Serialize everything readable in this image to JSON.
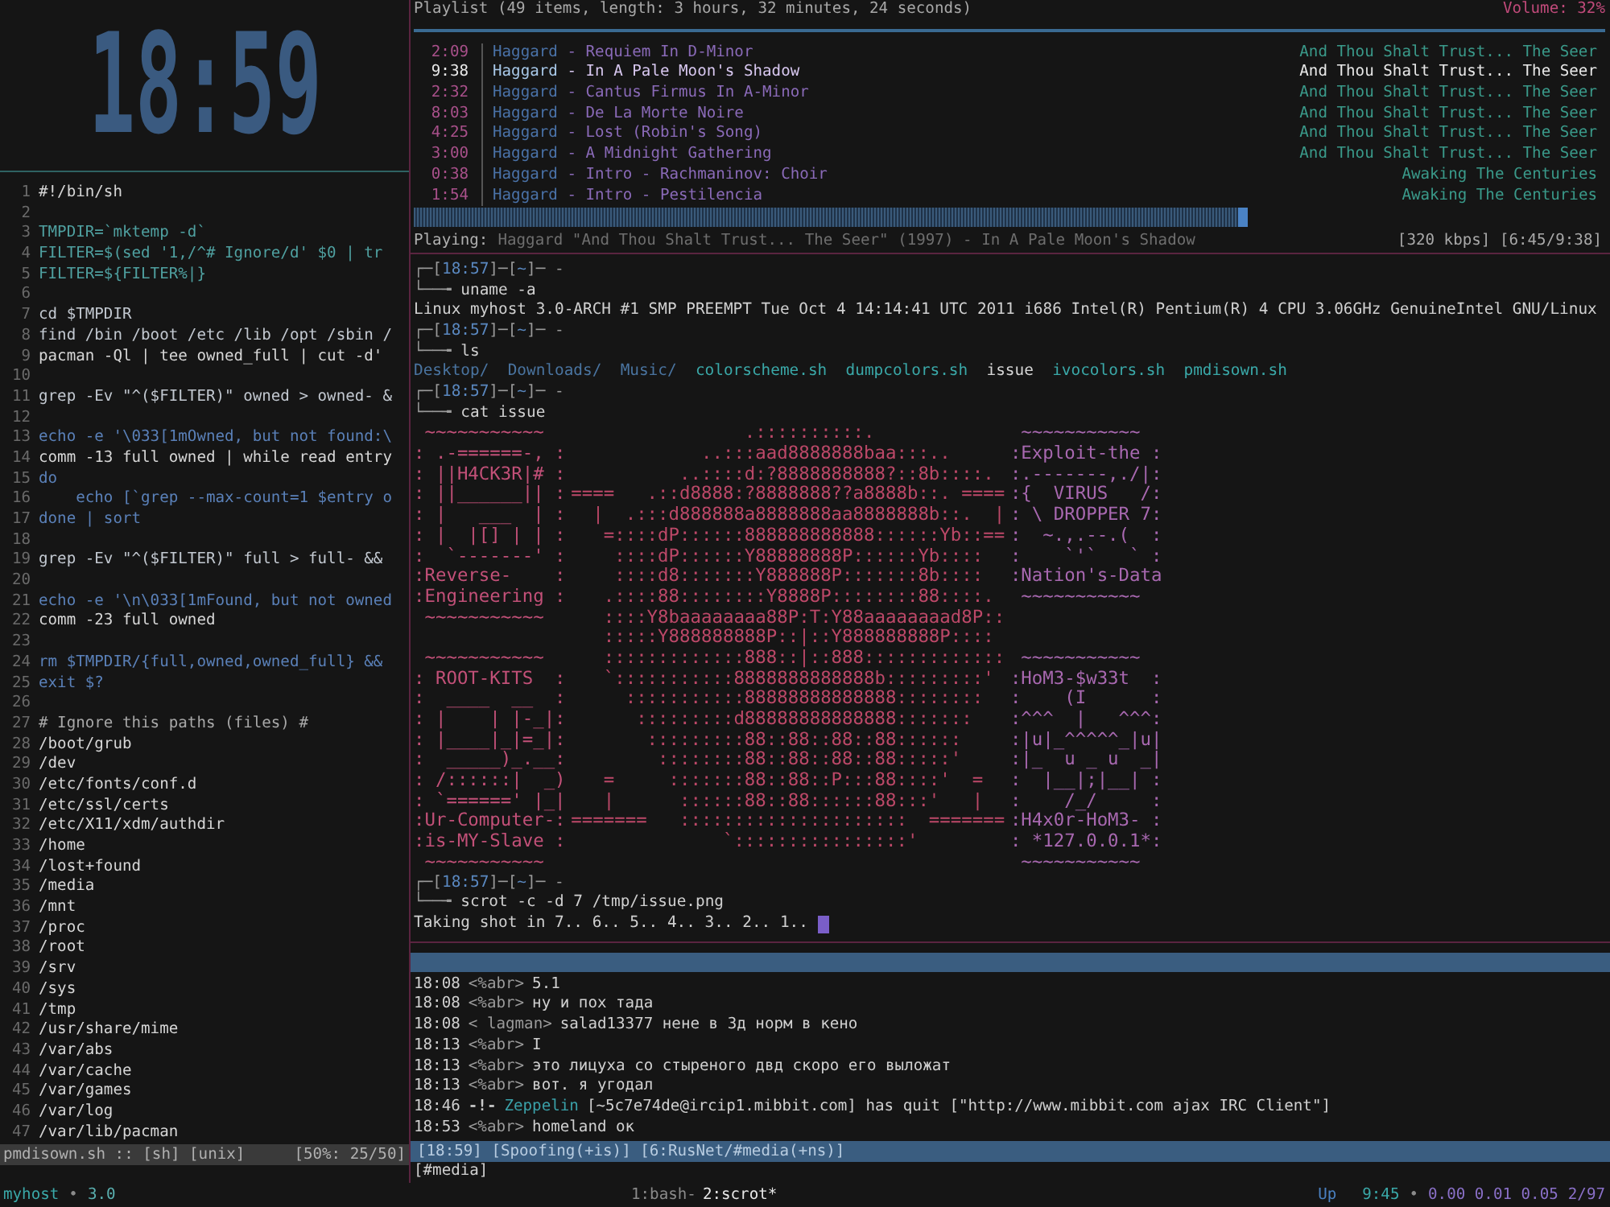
{
  "clock": "18:59",
  "editor": {
    "lines": [
      {
        "n": "1",
        "code": "#!/bin/sh",
        "kind": "plain"
      },
      {
        "n": "2"
      },
      {
        "n": "3",
        "code": "TMPDIR=`mktemp -d`",
        "kind": "assign"
      },
      {
        "n": "4",
        "code": "FILTER=$(sed '1,/^# Ignore/d' $0 | tr",
        "kind": "assign"
      },
      {
        "n": "5",
        "code": "FILTER=${FILTER%|}",
        "kind": "assign"
      },
      {
        "n": "6"
      },
      {
        "n": "7",
        "code": "cd $TMPDIR",
        "kind": "command"
      },
      {
        "n": "8",
        "code": "find /bin /boot /etc /lib /opt /sbin /",
        "kind": "command"
      },
      {
        "n": "9",
        "code": "pacman -Ql | tee owned_full | cut -d'",
        "kind": "plain"
      },
      {
        "n": "10"
      },
      {
        "n": "11",
        "code": "grep -Ev \"^($FILTER)\" owned > owned- &",
        "kind": "command"
      },
      {
        "n": "12"
      },
      {
        "n": "13",
        "code": "echo -e '\\033[1mOwned, but not found:\\",
        "kind": "keyword"
      },
      {
        "n": "14",
        "code": "comm -13 full owned | while read entry",
        "kind": "plain"
      },
      {
        "n": "15",
        "code": "do",
        "kind": "keyword"
      },
      {
        "n": "16",
        "code": "    echo [`grep --max-count=1 $entry o",
        "kind": "keyword"
      },
      {
        "n": "17",
        "code": "done | sort",
        "kind": "keyword"
      },
      {
        "n": "18"
      },
      {
        "n": "19",
        "code": "grep -Ev \"^($FILTER)\" full > full- &&",
        "kind": "command"
      },
      {
        "n": "20"
      },
      {
        "n": "21",
        "code": "echo -e '\\n\\033[1mFound, but not owned",
        "kind": "keyword"
      },
      {
        "n": "22",
        "code": "comm -23 full owned",
        "kind": "plain"
      },
      {
        "n": "23"
      },
      {
        "n": "24",
        "code": "rm $TMPDIR/{full,owned,owned_full} &&",
        "kind": "keyword"
      },
      {
        "n": "25",
        "code": "exit $?",
        "kind": "keyword"
      },
      {
        "n": "26"
      },
      {
        "n": "27",
        "code": "# Ignore this paths (files) #",
        "kind": "comment"
      },
      {
        "n": "28",
        "code": "/boot/grub",
        "kind": "plain"
      },
      {
        "n": "29",
        "code": "/dev",
        "kind": "plain"
      },
      {
        "n": "30",
        "code": "/etc/fonts/conf.d",
        "kind": "plain"
      },
      {
        "n": "31",
        "code": "/etc/ssl/certs",
        "kind": "plain"
      },
      {
        "n": "32",
        "code": "/etc/X11/xdm/authdir",
        "kind": "plain"
      },
      {
        "n": "33",
        "code": "/home",
        "kind": "plain"
      },
      {
        "n": "34",
        "code": "/lost+found",
        "kind": "plain"
      },
      {
        "n": "35",
        "code": "/media",
        "kind": "plain"
      },
      {
        "n": "36",
        "code": "/mnt",
        "kind": "plain"
      },
      {
        "n": "37",
        "code": "/proc",
        "kind": "plain"
      },
      {
        "n": "38",
        "code": "/root",
        "kind": "plain"
      },
      {
        "n": "39",
        "code": "/srv",
        "kind": "plain"
      },
      {
        "n": "40",
        "code": "/sys",
        "kind": "plain"
      },
      {
        "n": "41",
        "code": "/tmp",
        "kind": "plain"
      },
      {
        "n": "42",
        "code": "/usr/share/mime",
        "kind": "plain"
      },
      {
        "n": "43",
        "code": "/var/abs",
        "kind": "plain"
      },
      {
        "n": "44",
        "code": "/var/cache",
        "kind": "plain"
      },
      {
        "n": "45",
        "code": "/var/games",
        "kind": "plain"
      },
      {
        "n": "46",
        "code": "/var/log",
        "kind": "plain"
      },
      {
        "n": "47",
        "code": "/var/lib/pacman",
        "kind": "plain"
      }
    ],
    "status": {
      "file": "pmdisown.sh :: [sh] [unix]",
      "position": "[50%: 25/50]"
    }
  },
  "playlist": {
    "header": "Playlist (49 items, length: 3 hours, 32 minutes, 24 seconds)",
    "volume": "Volume: 32%",
    "tracks": [
      {
        "time": "2:09",
        "artist": "Haggard",
        "title": "- Requiem In D-Minor",
        "album": "And Thou Shalt Trust... The Seer",
        "selected": false
      },
      {
        "time": "9:38",
        "artist": "Haggard",
        "title": "- In A Pale Moon's Shadow",
        "album": "And Thou Shalt Trust... The Seer",
        "selected": true
      },
      {
        "time": "2:32",
        "artist": "Haggard",
        "title": "- Cantus Firmus In A-Minor",
        "album": "And Thou Shalt Trust... The Seer",
        "selected": false
      },
      {
        "time": "8:03",
        "artist": "Haggard",
        "title": "- De La Morte Noire",
        "album": "And Thou Shalt Trust... The Seer",
        "selected": false
      },
      {
        "time": "4:25",
        "artist": "Haggard",
        "title": "- Lost (Robin's Song)",
        "album": "And Thou Shalt Trust... The Seer",
        "selected": false
      },
      {
        "time": "3:00",
        "artist": "Haggard",
        "title": "- A Midnight Gathering",
        "album": "And Thou Shalt Trust... The Seer",
        "selected": false
      },
      {
        "time": "0:38",
        "artist": "Haggard",
        "title": "- Intro - Rachmaninov: Choir",
        "album": "Awaking The Centuries",
        "selected": false
      },
      {
        "time": "1:54",
        "artist": "Haggard",
        "title": "- Intro - Pestilencia",
        "album": "Awaking The Centuries",
        "selected": false
      }
    ],
    "progress": {
      "level": 0.7
    },
    "playing_label": "Playing:",
    "now_playing": "Haggard \"And Thou Shalt Trust... The Seer\" (1997) - In A Pale Moon's Shadow",
    "bitrate_time": "[320 kbps] [6:45/9:38]"
  },
  "terminal": [
    {
      "kind": "prompt",
      "segments": [
        "┌─[",
        "18:57",
        "]─[",
        "~",
        "]─ -"
      ],
      "arrow": "└──╼",
      "command": "uname -a"
    },
    {
      "kind": "output",
      "text": "Linux myhost 3.0-ARCH #1 SMP PREEMPT Tue Oct 4 14:14:41 UTC 2011 i686 Intel(R) Pentium(R) 4 CPU 3.06GHz GenuineIntel GNU/Linux"
    },
    {
      "kind": "prompt",
      "segments": [
        "┌─[",
        "18:57",
        "]─[",
        "~",
        "]─ -"
      ],
      "arrow": "└──╼",
      "command": "ls"
    },
    {
      "kind": "listing",
      "items": [
        {
          "name": "Desktop/",
          "kind": "dir"
        },
        {
          "name": "Downloads/",
          "kind": "dir"
        },
        {
          "name": "Music/",
          "kind": "dir"
        },
        {
          "name": "colorscheme.sh",
          "kind": "script"
        },
        {
          "name": "dumpcolors.sh",
          "kind": "script"
        },
        {
          "name": "issue",
          "kind": "file"
        },
        {
          "name": "ivocolors.sh",
          "kind": "script"
        },
        {
          "name": "pmdisown.sh",
          "kind": "script"
        }
      ]
    },
    {
      "kind": "prompt",
      "segments": [
        "┌─[",
        "18:57",
        "]─[",
        "~",
        "]─ -"
      ],
      "arrow": "└──╼",
      "command": "cat issue"
    },
    {
      "kind": "art",
      "rows": [
        {
          "left": " ~~~~~~~~~~~ ",
          "middle": "                .::::::::::.",
          "right": " ~~~~~~~~~~~ "
        },
        {
          "left": ": .-======-, :",
          "middle": "            ..:::aad8888888baa:::..",
          "right": ":Exploit-the :"
        },
        {
          "left": ": ||H4CK3R|# :",
          "middle": "          ..::::d:?8888888888?::8b::::.",
          "right": ":.-------,./|:"
        },
        {
          "left": ": ||______|| :",
          "middle": "====   .::d8888:?8888888??a8888b::. ====",
          "right": ":{  VIRUS   /:"
        },
        {
          "left": ": |   ___  | :",
          "middle": "  |  .:::d888888a8888888aa8888888b::.  |",
          "right": ": \\ DROPPER 7:"
        },
        {
          "left": ": |  |[] | | :",
          "middle": "   =::::dP::::::888888888888::::::Yb::==",
          "right": ":  ~.,.--.(  :"
        },
        {
          "left": ":  `-------' :",
          "middle": "    ::::dP::::::Y88888888P::::::Yb::::",
          "right": ":    `'`   ` :"
        },
        {
          "left": ":Reverse-    :",
          "middle": "    ::::d8:::::::Y888888P:::::::8b::::",
          "right": ":Nation's-Data"
        },
        {
          "left": ":Engineering :",
          "middle": "   .::::88::::::::Y8888P::::::::88::::.",
          "right": " ~~~~~~~~~~~ "
        },
        {
          "left": " ~~~~~~~~~~~ ",
          "middle": "   ::::Y8baaaaaaaa88P:T:Y88aaaaaaaad8P::"
        },
        {
          "middle": "   :::::Y888888888P::|::Y888888888P::::"
        },
        {
          "left": " ~~~~~~~~~~~ ",
          "middle": "   :::::::::::::888::|::888:::::::::::::",
          "right": " ~~~~~~~~~~~ "
        },
        {
          "left": ": ROOT-KITS  :",
          "middle": "   `:::::::::::8888888888888b:::::::::'",
          "right": ":HoM3-$w33t  :"
        },
        {
          "left": ":  ____  __  :",
          "middle": "     :::::::::::88888888888888::::::::",
          "right": ":    (I      :"
        },
        {
          "left": ": |    | |-_|:",
          "middle": "      :::::::::d88888888888888:::::::",
          "right": ":^^^  |   ^^^:"
        },
        {
          "left": ": |____|_|=_|:",
          "middle": "       :::::::::88::88::88::88::::::",
          "right": ":|u|_^^^^^_|u|"
        },
        {
          "left": ":  _____)_.__:",
          "middle": "        ::::::::88::88::88::88:::::'",
          "right": ":|_  u _ u  _|"
        },
        {
          "left": ": /::::::|  _)",
          "middle": "   =     :::::::88::88::P:::88::::'  =",
          "right": ":  |__|;|__| :"
        },
        {
          "left": ": `======' |_|",
          "middle": "   |      ::::::88::88::::::88:::'   |",
          "right": ":    /_/     :"
        },
        {
          "left": ":Ur-Computer-:",
          "middle": "=======   :::::::::::::::::::::  =======",
          "right": ":H4x0r-HoM3- :"
        },
        {
          "left": ":is-MY-Slave :",
          "middle": "              `::::::::::::::::'",
          "right": ": *127.0.0.1*:"
        },
        {
          "left": " ~~~~~~~~~~~ ",
          "right": " ~~~~~~~~~~~ "
        }
      ]
    },
    {
      "kind": "prompt",
      "segments": [
        "┌─[",
        "18:57",
        "]─[",
        "~",
        "]─ -"
      ],
      "arrow": "└──╼",
      "command": "scrot -c -d 7 /tmp/issue.png"
    },
    {
      "kind": "output",
      "text": "Taking shot in 7.. 6.. 5.. 4.. 3.. 2.. 1..",
      "cursor": true
    }
  ],
  "irc": {
    "lines": [
      {
        "kind": "message",
        "time": "18:08",
        "nick": "<%abr>",
        "text": "5.1"
      },
      {
        "kind": "message",
        "time": "18:08",
        "nick": "<%abr>",
        "text": "ну и пох тада"
      },
      {
        "kind": "message",
        "time": "18:08",
        "nick": "< lagman>",
        "text": "salad13377 нене в 3д норм в кено"
      },
      {
        "kind": "message",
        "time": "18:13",
        "nick": "<%abr>",
        "text": "I"
      },
      {
        "kind": "message",
        "time": "18:13",
        "nick": "<%abr>",
        "text": "это лицуха со стыреного двд скоро его выложат"
      },
      {
        "kind": "message",
        "time": "18:13",
        "nick": "<%abr>",
        "text": "вот. я угодал"
      },
      {
        "kind": "event",
        "time": "18:46",
        "nick": "-!-",
        "who": "Zeppelin",
        "text": "[~5c7e74de@ircip1.mibbit.com] has quit [\"http://www.mibbit.com ajax IRC Client\"]"
      },
      {
        "kind": "message",
        "time": "18:53",
        "nick": "<%abr>",
        "text": "homeland ок"
      }
    ],
    "status": "[18:59] [Spoofing(+is)] [6:RusNet/#media(+ns)]",
    "input": "[#media]"
  },
  "status_bar": {
    "host": "myhost",
    "separator": "•",
    "kernel": "3.0",
    "windows": [
      {
        "label": "1:bash-",
        "selected": false
      },
      {
        "label": "2:scrot*",
        "selected": true
      }
    ],
    "stats": [
      {
        "text": "Up",
        "kind": "label"
      },
      {
        "text": "9:45",
        "kind": "value"
      },
      {
        "text": "•",
        "kind": "sep"
      },
      {
        "text": "0.00 0.01 0.05",
        "kind": "load"
      },
      {
        "text": "2/97",
        "kind": "load"
      }
    ]
  }
}
